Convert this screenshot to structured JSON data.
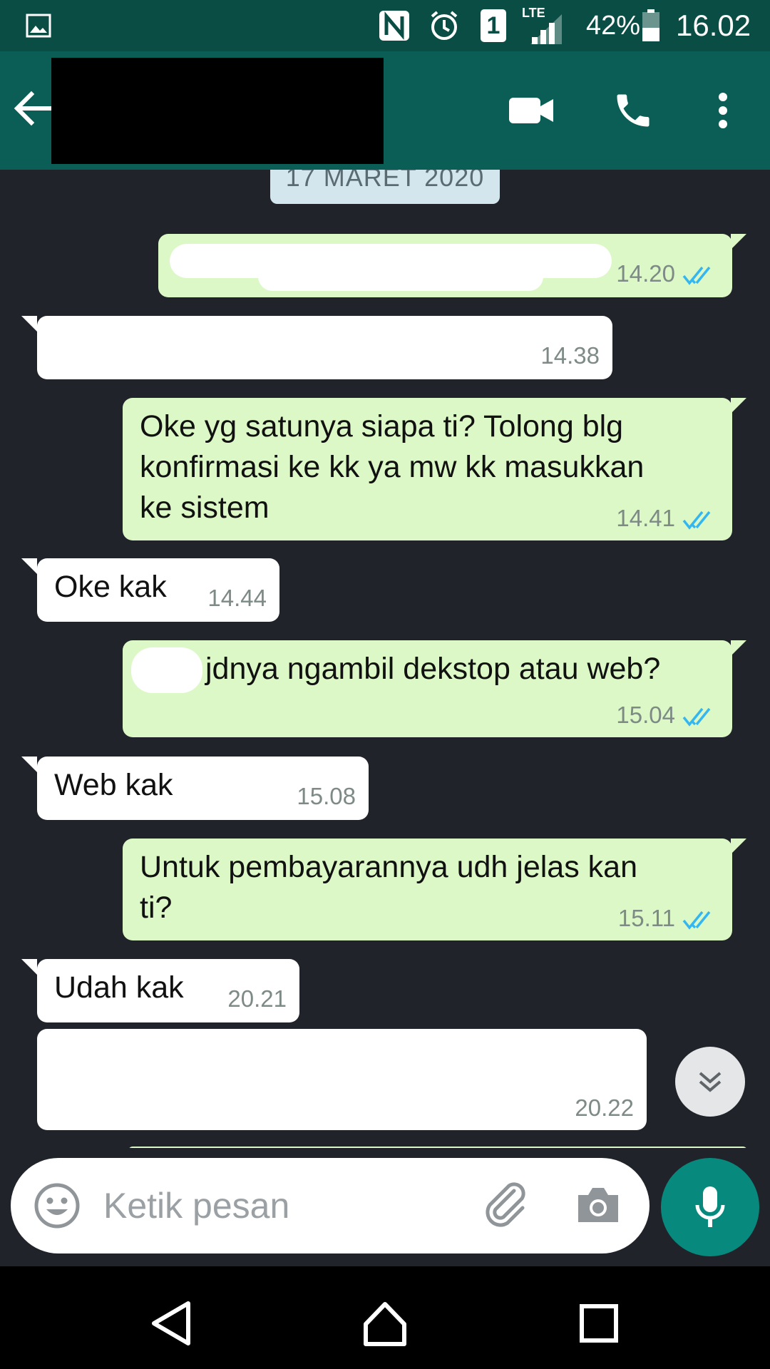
{
  "status_bar": {
    "battery": "42%",
    "time": "16.02",
    "network": "LTE",
    "sim_slot": "1",
    "icons": [
      "gallery-icon",
      "nfc-icon",
      "alarm-icon",
      "sim-icon",
      "signal-icon",
      "battery-icon"
    ]
  },
  "header": {
    "icons": [
      "back-arrow-icon",
      "video-call-icon",
      "phone-icon",
      "more-vert-icon"
    ]
  },
  "chat": {
    "date_chip": "17 MARET 2020",
    "messages": [
      {
        "dir": "out",
        "text": "",
        "time": "14.20",
        "read": true
      },
      {
        "dir": "in",
        "text": "",
        "time": "14.38"
      },
      {
        "dir": "out",
        "text": "Oke yg satunya siapa ti? Tolong blg\nkonfirmasi ke kk ya mw kk masukkan\nke sistem",
        "time": "14.41",
        "read": true
      },
      {
        "dir": "in",
        "text": "Oke kak",
        "time": "14.44"
      },
      {
        "dir": "out",
        "text": "jdnya ngambil dekstop atau web?",
        "time": "15.04",
        "read": true
      },
      {
        "dir": "in",
        "text": "Web kak",
        "time": "15.08"
      },
      {
        "dir": "out",
        "text": "Untuk pembayarannya udh jelas kan\nti?",
        "time": "15.11",
        "read": true
      },
      {
        "dir": "in",
        "text": "Udah kak",
        "time": "20.21"
      },
      {
        "dir": "in",
        "text": "",
        "time": "20.22"
      }
    ]
  },
  "composer": {
    "placeholder": "Ketik pesan",
    "icons": [
      "emoji-icon",
      "attach-icon",
      "camera-icon",
      "mic-icon"
    ]
  },
  "colors": {
    "header": "#0b5e55",
    "status_bar": "#0a4d44",
    "chat_bg": "#20242a",
    "outgoing": "#dcf8c6",
    "incoming": "#ffffff",
    "read_ticks": "#34b7f1",
    "mic_button": "#078a7d"
  }
}
